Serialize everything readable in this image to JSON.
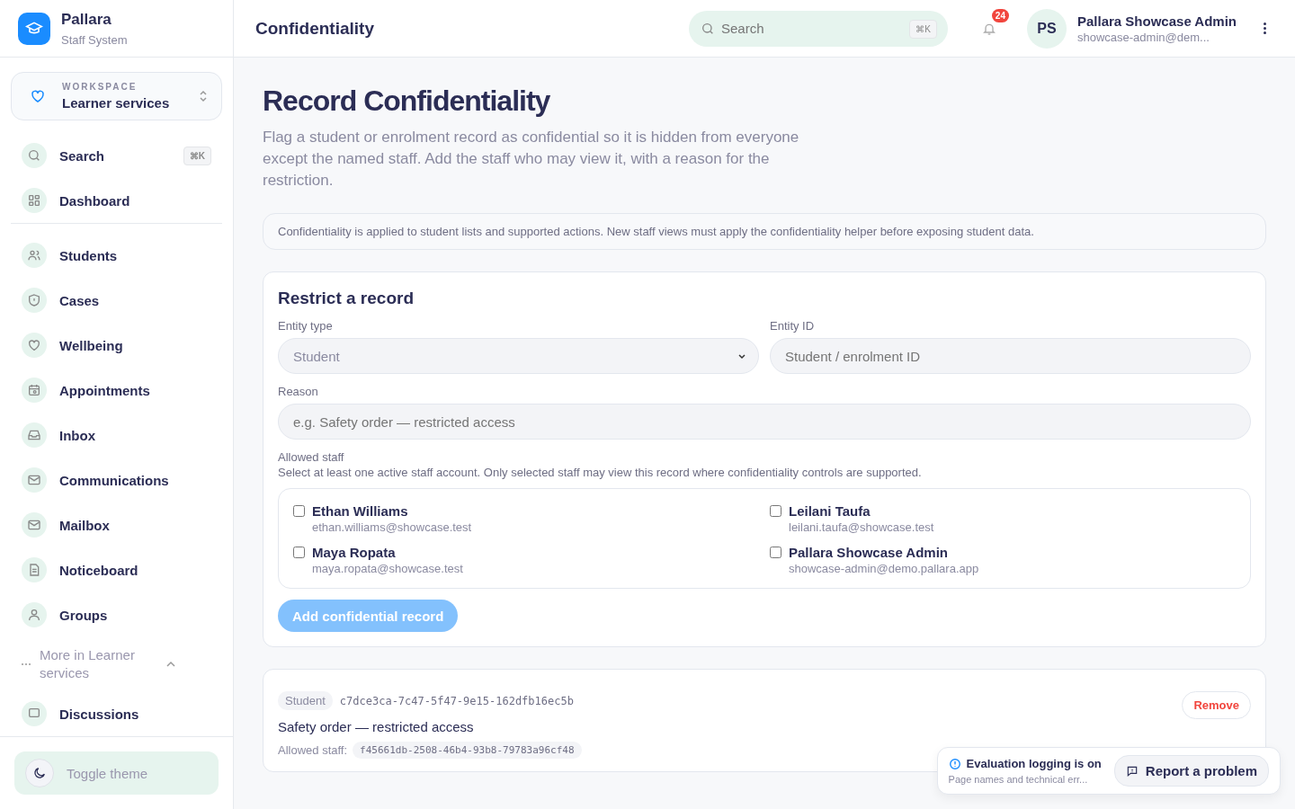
{
  "brand": {
    "name": "Pallara",
    "subtitle": "Staff System"
  },
  "workspace": {
    "label": "WORKSPACE",
    "name": "Learner services"
  },
  "nav_top": [
    {
      "label": "Search",
      "shortcut": "⌘K"
    },
    {
      "label": "Dashboard"
    }
  ],
  "nav": [
    {
      "label": "Students"
    },
    {
      "label": "Cases"
    },
    {
      "label": "Wellbeing"
    },
    {
      "label": "Appointments"
    },
    {
      "label": "Inbox"
    },
    {
      "label": "Communications"
    },
    {
      "label": "Mailbox"
    },
    {
      "label": "Noticeboard"
    },
    {
      "label": "Groups"
    }
  ],
  "more": {
    "label": "More in Learner services",
    "expanded": true,
    "items": [
      {
        "label": "Discussions"
      }
    ]
  },
  "theme_toggle": "Toggle theme",
  "header": {
    "title": "Confidentiality",
    "search_placeholder": "Search",
    "search_shortcut": "⌘K",
    "notifications": "24",
    "avatar": "PS",
    "user_name": "Pallara Showcase Admin",
    "user_email": "showcase-admin@dem..."
  },
  "page": {
    "title": "Record Confidentiality",
    "description": "Flag a student or enrolment record as confidential so it is hidden from everyone except the named staff. Add the staff who may view it, with a reason for the restriction.",
    "notice": "Confidentiality is applied to student lists and supported actions. New staff views must apply the confidentiality helper before exposing student data."
  },
  "form": {
    "title": "Restrict a record",
    "entity_type_label": "Entity type",
    "entity_type_value": "Student",
    "entity_id_label": "Entity ID",
    "entity_id_placeholder": "Student / enrolment ID",
    "reason_label": "Reason",
    "reason_placeholder": "e.g. Safety order — restricted access",
    "staff_label": "Allowed staff",
    "staff_hint": "Select at least one active staff account. Only selected staff may view this record where confidentiality controls are supported.",
    "staff": [
      {
        "name": "Ethan Williams",
        "email": "ethan.williams@showcase.test",
        "checked": false
      },
      {
        "name": "Leilani Taufa",
        "email": "leilani.taufa@showcase.test",
        "checked": false
      },
      {
        "name": "Maya Ropata",
        "email": "maya.ropata@showcase.test",
        "checked": false
      },
      {
        "name": "Pallara Showcase Admin",
        "email": "showcase-admin@demo.pallara.app",
        "checked": false
      }
    ],
    "submit": {
      "label": "Add confidential record",
      "disabled": true
    }
  },
  "records": [
    {
      "type": "Student",
      "id": "c7dce3ca-7c47-5f47-9e15-162dfb16ec5b",
      "reason": "Safety order — restricted access",
      "staff_label": "Allowed staff:",
      "staff_ids": [
        "f45661db-2508-46b4-93b8-79783a96cf48"
      ],
      "remove": "Remove"
    }
  ],
  "eval_banner": {
    "title": "Evaluation logging is on",
    "detail": "Page names and technical err...",
    "report": "Report a problem"
  }
}
